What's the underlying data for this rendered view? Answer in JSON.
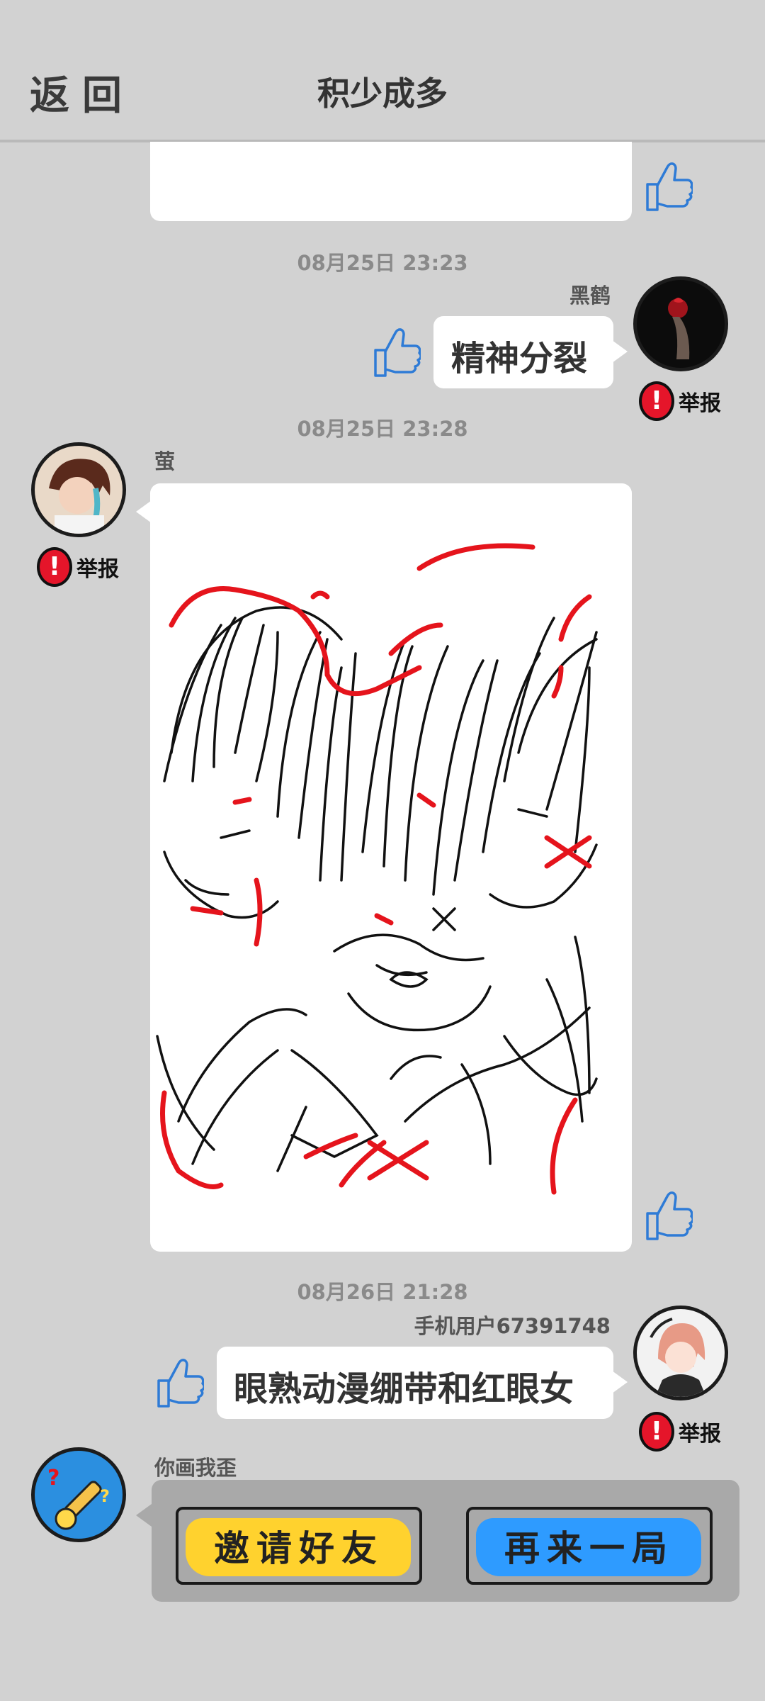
{
  "header": {
    "back_label": "返回",
    "title": "积少成多"
  },
  "messages": [
    {
      "timestamp": "08月25日 23:23",
      "user": "黑鹤",
      "text": "精神分裂",
      "report": "举报"
    },
    {
      "timestamp": "08月25日 23:28",
      "user": "萤",
      "report": "举报"
    },
    {
      "timestamp": "08月26日 21:28",
      "user": "手机用户67391748",
      "text": "眼熟动漫绷带和红眼女",
      "report": "举报"
    }
  ],
  "bot": {
    "name": "你画我歪",
    "buttons": [
      {
        "label": "邀请好友",
        "color": "#ffd22e"
      },
      {
        "label": "再来一局",
        "color": "#2e9bff"
      }
    ]
  },
  "icons": {
    "thumb": "thumbs-up-icon",
    "report": "exclamation-icon"
  },
  "colors": {
    "report_red": "#e5152a",
    "thumb_blue": "#2e7bd6"
  }
}
